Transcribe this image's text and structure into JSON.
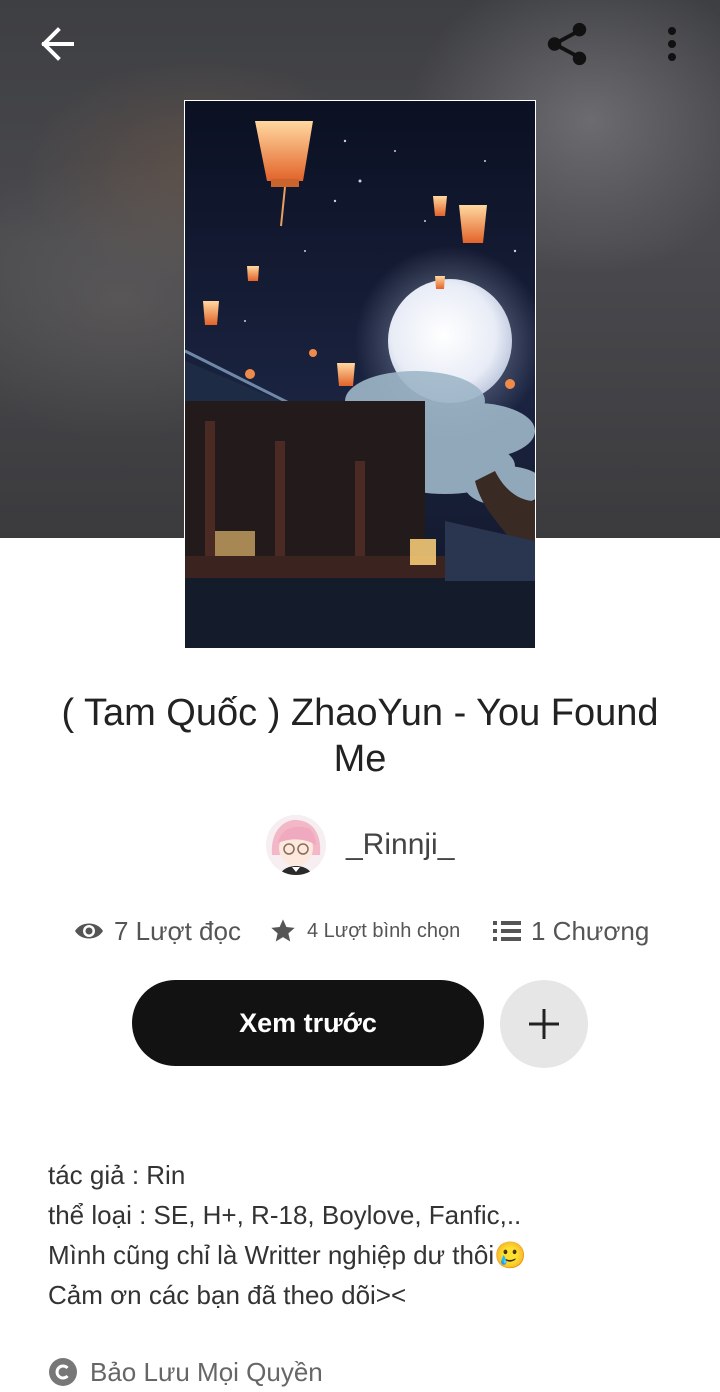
{
  "header": {
    "back_icon": "arrow-left-icon",
    "share_icon": "share-icon",
    "more_icon": "more-vertical-icon"
  },
  "story": {
    "title": "( Tam Quốc ) ZhaoYun - You Found Me",
    "author": "_Rinnji_",
    "stats": {
      "reads": "7 Lượt đọc",
      "votes": "4 Lượt bình chọn",
      "chapters": "1 Chương"
    },
    "read_button_label": "Xem trước",
    "description": [
      "tác giả : Rin",
      "thể loại : SE, H+, R-18, Boylove, Fanfic,..",
      "Mình cũng chỉ là Writter nghiệp dư thôi🥲",
      "Cảm ơn các bạn đã theo dõi><"
    ],
    "copyright": "Bảo Lưu Mọi Quyền"
  },
  "colors": {
    "primary_button": "#121212",
    "add_button": "#e6e6e6",
    "text": "#222222"
  }
}
